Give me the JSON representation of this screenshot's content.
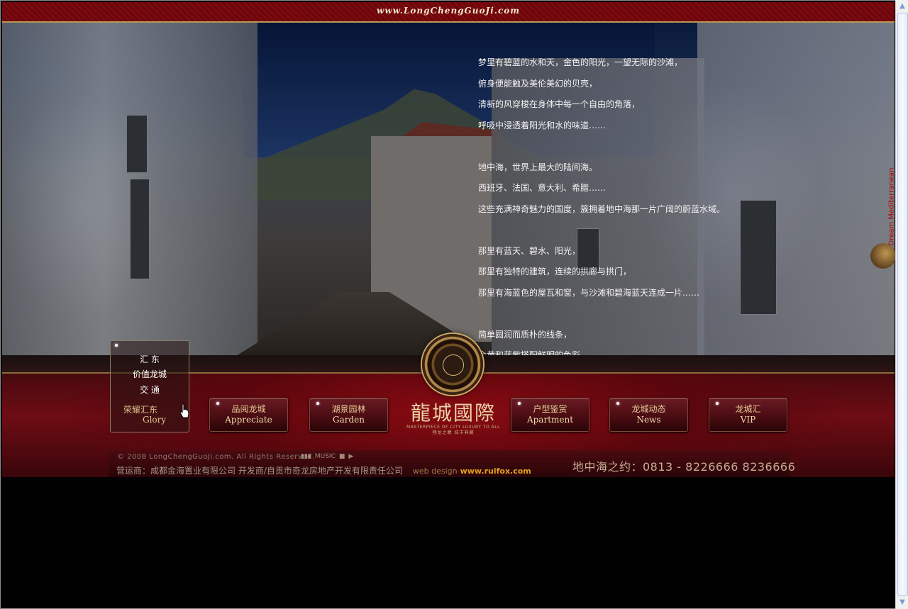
{
  "site_url": "www.LongChengGuoJi.com",
  "side_tab_label": "Dream Mediterranean",
  "poem": [
    "梦里有碧蓝的水和天，金色的阳光，一望无际的沙滩，",
    "俯身便能触及美伦美幻的贝壳，",
    "清新的风穿梭在身体中每一个自由的角落，",
    "呼吸中浸透着阳光和水的味道……",
    "",
    "地中海，世界上最大的陆间海。",
    "西班牙、法国、意大利、希腊……",
    "这些充满神奇魅力的国度，簇拥着地中海那一片广阔的蔚蓝水域。",
    "",
    "那里有蓝天、碧水、阳光，",
    "那里有独特的建筑，连续的拱廊与拱门，",
    "那里有海蓝色的屋瓦和窗，与沙滩和碧海蓝天连成一片……",
    "",
    "简单圆润而质朴的线条，",
    "金黄和蓝紫搭配鲜明的色彩"
  ],
  "dropdown": {
    "items": [
      "汇  东",
      "价值龙城",
      "交  通"
    ],
    "current_zh": "荣耀汇东",
    "current_en": "Glory"
  },
  "nav": [
    {
      "zh": "品阅龙城",
      "en": "Appreciate"
    },
    {
      "zh": "湖景园林",
      "en": "Garden"
    },
    {
      "zh": "户型鉴赏",
      "en": "Apartment"
    },
    {
      "zh": "龙城动态",
      "en": "News"
    },
    {
      "zh": "龙城汇",
      "en": "VIP"
    }
  ],
  "logo": {
    "name": "龍城國際",
    "tagline_en": "MASTERPIECE OF CITY LUXURY TO ALL",
    "tagline_zh": "翔龙之巅  城市典藏"
  },
  "footer": {
    "copyright": "© 2008 LongChengGuoJi.com. All Rights Reserved.",
    "music_label": "MUSIC",
    "operator": "营运商：成都金海置业有限公司    开发商/自贡市奇龙房地产开发有限责任公司",
    "web_design_label": "web design",
    "web_design_link": "www.ruifox.com",
    "hotline": "地中海之约：0813 - 8226666    8236666"
  }
}
